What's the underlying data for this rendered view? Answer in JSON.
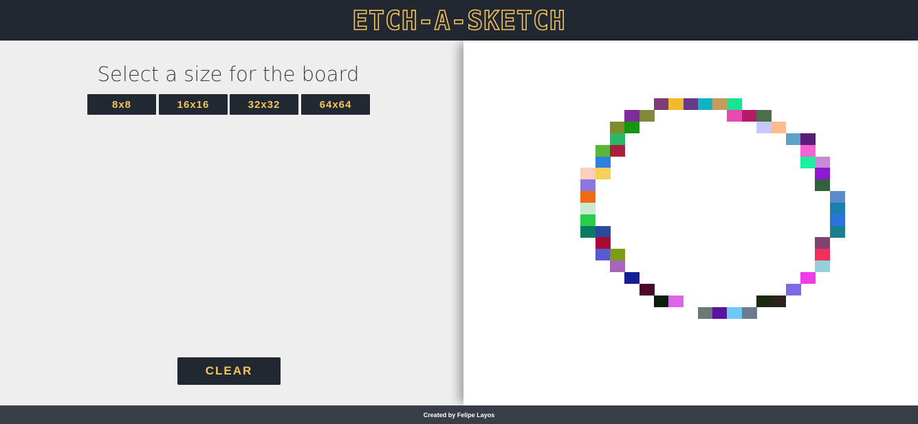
{
  "header": {
    "logo": "ETCH-A-SKETCH"
  },
  "controls": {
    "title": "Select a size for the board",
    "sizes": [
      "8x8",
      "16x16",
      "32x32",
      "64x64"
    ],
    "clear_label": "CLEAR"
  },
  "footer": {
    "credit": "Created by Felipe Layos"
  },
  "colors": {
    "header_bg": "#222831",
    "accent": "#f4c55c",
    "panel_bg": "#eeeeee",
    "footer_bg": "#393e46"
  },
  "board": {
    "grid_size": 32,
    "painted_cells": [
      {
        "col": 13,
        "row": 5,
        "color": "#7b3b74"
      },
      {
        "col": 14,
        "row": 5,
        "color": "#f0b82a"
      },
      {
        "col": 15,
        "row": 5,
        "color": "#643a8a"
      },
      {
        "col": 16,
        "row": 5,
        "color": "#0fb3c2"
      },
      {
        "col": 17,
        "row": 5,
        "color": "#c79a60"
      },
      {
        "col": 18,
        "row": 5,
        "color": "#1ae28f"
      },
      {
        "col": 11,
        "row": 6,
        "color": "#7c2b9c"
      },
      {
        "col": 12,
        "row": 6,
        "color": "#83883a"
      },
      {
        "col": 18,
        "row": 6,
        "color": "#e74ab4"
      },
      {
        "col": 19,
        "row": 6,
        "color": "#b71a64"
      },
      {
        "col": 20,
        "row": 6,
        "color": "#4a6e4a"
      },
      {
        "col": 10,
        "row": 7,
        "color": "#7c8c2a"
      },
      {
        "col": 11,
        "row": 7,
        "color": "#16960f"
      },
      {
        "col": 20,
        "row": 7,
        "color": "#c8c8ff"
      },
      {
        "col": 21,
        "row": 7,
        "color": "#ffbc8c"
      },
      {
        "col": 10,
        "row": 8,
        "color": "#28b866"
      },
      {
        "col": 22,
        "row": 8,
        "color": "#5fa0c8"
      },
      {
        "col": 23,
        "row": 8,
        "color": "#5a1e7a"
      },
      {
        "col": 9,
        "row": 9,
        "color": "#5ab63a"
      },
      {
        "col": 10,
        "row": 9,
        "color": "#a8203c"
      },
      {
        "col": 23,
        "row": 9,
        "color": "#f364d2"
      },
      {
        "col": 9,
        "row": 10,
        "color": "#2e80e0"
      },
      {
        "col": 23,
        "row": 10,
        "color": "#1af0a0"
      },
      {
        "col": 24,
        "row": 10,
        "color": "#c78ad6"
      },
      {
        "col": 8,
        "row": 11,
        "color": "#f8d0bc"
      },
      {
        "col": 9,
        "row": 11,
        "color": "#f4d05a"
      },
      {
        "col": 24,
        "row": 11,
        "color": "#8c1ad4"
      },
      {
        "col": 8,
        "row": 12,
        "color": "#8a78e0"
      },
      {
        "col": 24,
        "row": 12,
        "color": "#346040"
      },
      {
        "col": 8,
        "row": 13,
        "color": "#f06a14"
      },
      {
        "col": 25,
        "row": 13,
        "color": "#5a8ac8"
      },
      {
        "col": 8,
        "row": 14,
        "color": "#c8e8d0"
      },
      {
        "col": 25,
        "row": 14,
        "color": "#1a7eb0"
      },
      {
        "col": 8,
        "row": 15,
        "color": "#28cc46"
      },
      {
        "col": 25,
        "row": 15,
        "color": "#2a72e0"
      },
      {
        "col": 8,
        "row": 16,
        "color": "#0a7a5e"
      },
      {
        "col": 9,
        "row": 16,
        "color": "#2a4a9c"
      },
      {
        "col": 25,
        "row": 16,
        "color": "#1a8090"
      },
      {
        "col": 9,
        "row": 17,
        "color": "#a80a34"
      },
      {
        "col": 24,
        "row": 17,
        "color": "#80426e"
      },
      {
        "col": 9,
        "row": 18,
        "color": "#5a5ad0"
      },
      {
        "col": 10,
        "row": 18,
        "color": "#7c9a14"
      },
      {
        "col": 24,
        "row": 18,
        "color": "#f0305a"
      },
      {
        "col": 10,
        "row": 19,
        "color": "#a864b8"
      },
      {
        "col": 24,
        "row": 19,
        "color": "#96d0d8"
      },
      {
        "col": 11,
        "row": 20,
        "color": "#121e96"
      },
      {
        "col": 23,
        "row": 20,
        "color": "#f03ce8"
      },
      {
        "col": 12,
        "row": 21,
        "color": "#4c0a2a"
      },
      {
        "col": 22,
        "row": 21,
        "color": "#7a6ae8"
      },
      {
        "col": 13,
        "row": 22,
        "color": "#0a1e0a"
      },
      {
        "col": 14,
        "row": 22,
        "color": "#dc64e8"
      },
      {
        "col": 20,
        "row": 22,
        "color": "#1a2a0a"
      },
      {
        "col": 21,
        "row": 22,
        "color": "#2e2220"
      },
      {
        "col": 16,
        "row": 23,
        "color": "#6a7a7a"
      },
      {
        "col": 17,
        "row": 23,
        "color": "#5a14a0"
      },
      {
        "col": 18,
        "row": 23,
        "color": "#6ec8f8"
      },
      {
        "col": 19,
        "row": 23,
        "color": "#6a7a90"
      }
    ]
  }
}
